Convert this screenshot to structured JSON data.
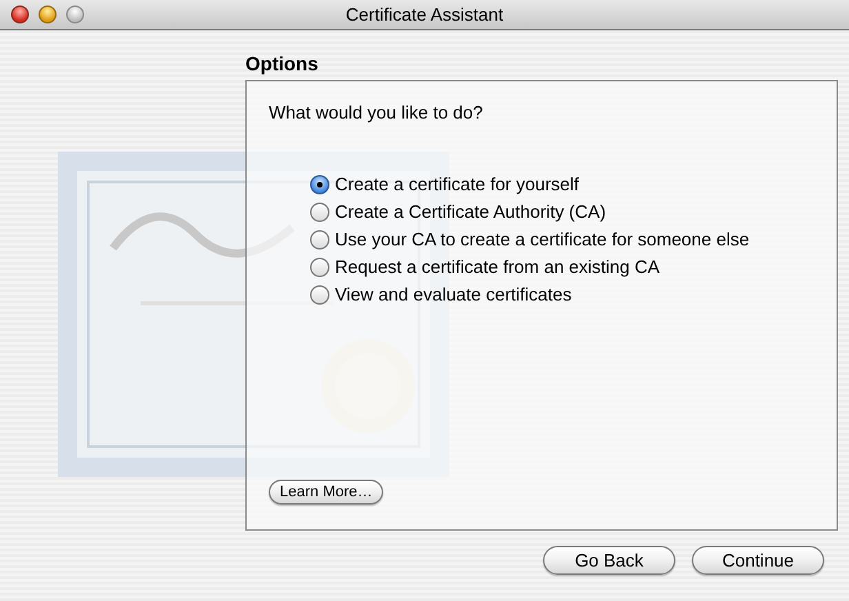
{
  "window": {
    "title": "Certificate Assistant"
  },
  "section_title": "Options",
  "question": "What would you like to do?",
  "options": [
    {
      "label": "Create a certificate for yourself",
      "selected": true
    },
    {
      "label": "Create a Certificate Authority (CA)",
      "selected": false
    },
    {
      "label": "Use your CA to create a certificate for someone else",
      "selected": false
    },
    {
      "label": "Request a certificate from an existing CA",
      "selected": false
    },
    {
      "label": "View and evaluate certificates",
      "selected": false
    }
  ],
  "learn_more_button": "Learn More…",
  "buttons": [
    "Go Back",
    "Continue"
  ]
}
